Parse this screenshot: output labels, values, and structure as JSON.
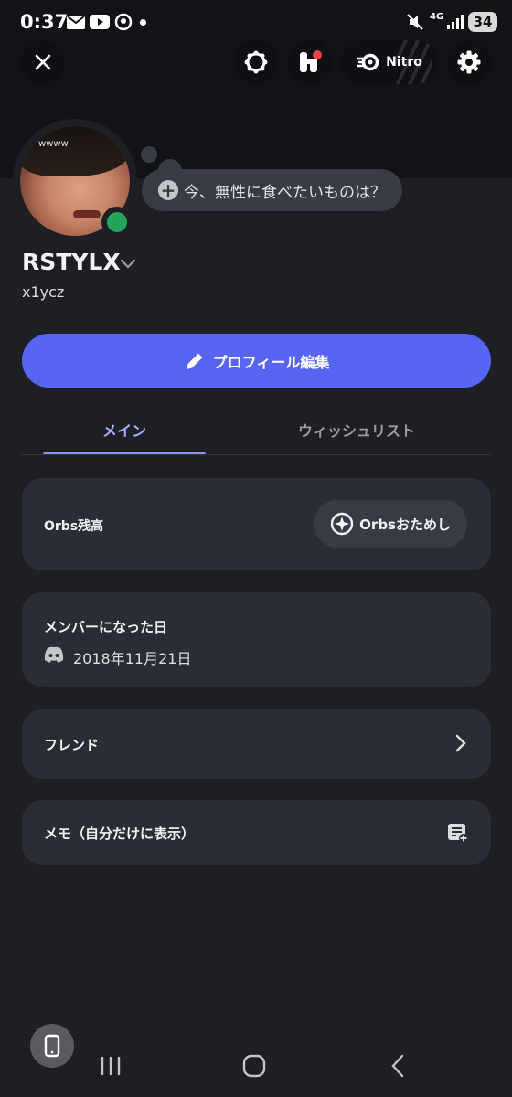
{
  "status_bar": {
    "time": "0:37",
    "network": "4G",
    "battery": "34",
    "icons": [
      "mail-icon",
      "youtube-icon",
      "location-icon",
      "mute-icon",
      "signal-icon"
    ]
  },
  "header": {
    "close_icon": "close-icon",
    "nitro_label": "Nitro"
  },
  "profile": {
    "avatar_caption": "wwww",
    "status_prompt": "今、無性に食べたいものは？",
    "display_name": "RSTYLX",
    "username": "x1ycz",
    "online_color": "#23a55a"
  },
  "edit_button": {
    "label": "プロフィール編集"
  },
  "tabs": [
    {
      "label": "メイン",
      "active": true
    },
    {
      "label": "ウィッシュリスト",
      "active": false
    }
  ],
  "orbs_card": {
    "title": "Orbs残高",
    "button_label": "Orbsおためし"
  },
  "member_card": {
    "title": "メンバーになった日",
    "date": "2018年11月21日"
  },
  "friends_card": {
    "title": "フレンド"
  },
  "note_card": {
    "title": "メモ（自分だけに表示）"
  },
  "colors": {
    "background": "#1e1f24",
    "card": "#2b2d34",
    "accent": "#5865f2",
    "active_tab": "#a4acff"
  }
}
